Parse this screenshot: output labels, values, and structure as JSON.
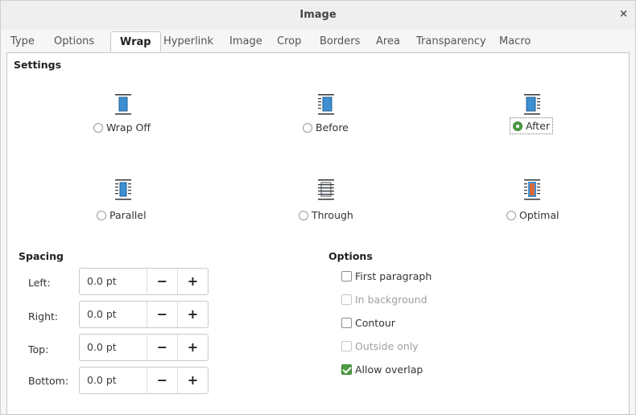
{
  "window": {
    "title": "Image",
    "close_glyph": "×"
  },
  "tabs": [
    {
      "label": "Type"
    },
    {
      "label": "Options"
    },
    {
      "label": "Wrap",
      "active": true
    },
    {
      "label": "Hyperlink"
    },
    {
      "label": "Image"
    },
    {
      "label": "Crop"
    },
    {
      "label": "Borders"
    },
    {
      "label": "Area"
    },
    {
      "label": "Transparency"
    },
    {
      "label": "Macro"
    }
  ],
  "settings": {
    "title": "Settings",
    "modes": [
      {
        "label": "Wrap Off",
        "icon": "wrap-off-icon",
        "selected": false
      },
      {
        "label": "Before",
        "icon": "wrap-before-icon",
        "selected": false
      },
      {
        "label": "After",
        "icon": "wrap-after-icon",
        "selected": true
      },
      {
        "label": "Parallel",
        "icon": "wrap-parallel-icon",
        "selected": false
      },
      {
        "label": "Through",
        "icon": "wrap-through-icon",
        "selected": false
      },
      {
        "label": "Optimal",
        "icon": "wrap-optimal-icon",
        "selected": false
      }
    ]
  },
  "spacing": {
    "title": "Spacing",
    "fields": [
      {
        "label": "Left:",
        "value": "0.0 pt"
      },
      {
        "label": "Right:",
        "value": "0.0 pt"
      },
      {
        "label": "Top:",
        "value": "0.0 pt"
      },
      {
        "label": "Bottom:",
        "value": "0.0 pt"
      }
    ],
    "minus": "−",
    "plus": "+"
  },
  "options": {
    "title": "Options",
    "items": [
      {
        "label": "First paragraph",
        "checked": false,
        "enabled": true
      },
      {
        "label": "In background",
        "checked": false,
        "enabled": false
      },
      {
        "label": "Contour",
        "checked": false,
        "enabled": true
      },
      {
        "label": "Outside only",
        "checked": false,
        "enabled": false
      },
      {
        "label": "Allow overlap",
        "checked": true,
        "enabled": true
      }
    ]
  },
  "colors": {
    "accent": "#4e9a46",
    "icon_blue": "#3d8fd1"
  }
}
